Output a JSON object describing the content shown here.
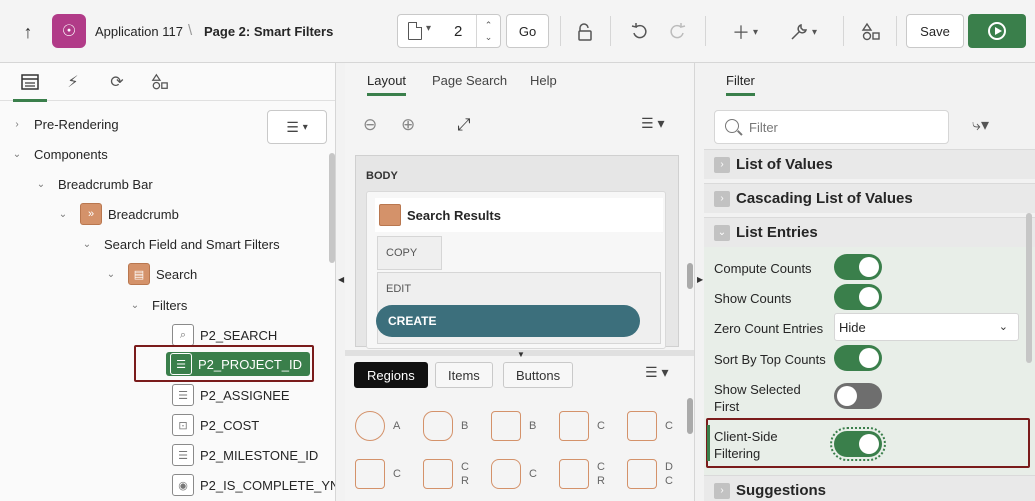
{
  "toolbar": {
    "up_glyph": "↑",
    "app_icon_glyph": "☉",
    "app_name": "Application 117",
    "separator": "\\",
    "page_name": "Page 2: Smart Filters",
    "page_number": "2",
    "go_label": "Go",
    "save_label": "Save",
    "icons": [
      "up-arrow-icon",
      "app-rocket-icon",
      "page-icon",
      "lock-icon",
      "undo-icon",
      "redo-icon",
      "plus-icon",
      "wrench-icon",
      "shapes-icon",
      "run-icon"
    ]
  },
  "left": {
    "tabs": [
      "rendering-tab",
      "dynamic-actions-tab",
      "processing-tab",
      "shared-components-tab"
    ],
    "tree": {
      "pre_rendering": "Pre-Rendering",
      "components": "Components",
      "breadcrumb_bar": "Breadcrumb Bar",
      "breadcrumb": "Breadcrumb",
      "search_field": "Search Field and Smart Filters",
      "search": "Search",
      "filters": "Filters",
      "items": [
        "P2_SEARCH",
        "P2_PROJECT_ID",
        "P2_ASSIGNEE",
        "P2_COST",
        "P2_MILESTONE_ID",
        "P2_IS_COMPLETE_YN"
      ]
    }
  },
  "middle": {
    "tabs": [
      "Layout",
      "Page Search",
      "Help"
    ],
    "body_label": "BODY",
    "region_title": "Search Results",
    "slot_copy": "COPY",
    "slot_edit": "EDIT",
    "create_label": "CREATE",
    "gallery_tabs": [
      "Regions",
      "Items",
      "Buttons"
    ],
    "gallery_items": [
      {
        "label": "A",
        "icon": "user-icon"
      },
      {
        "label": "B",
        "icon": "badge-icon"
      },
      {
        "label": "B",
        "icon": "breadcrumb-icon"
      },
      {
        "label": "C",
        "icon": "calendar-icon"
      },
      {
        "label": "C",
        "icon": "card-icon"
      },
      {
        "label": "C",
        "icon": "chart-icon"
      },
      {
        "label": "C\nR",
        "icon": "classic-report-icon"
      },
      {
        "label": "C",
        "icon": "comments-icon"
      },
      {
        "label": "C\nR",
        "icon": "checklist-icon"
      },
      {
        "label": "D\nC",
        "icon": "dynamic-content-icon"
      }
    ]
  },
  "right": {
    "tab": "Filter",
    "filter_placeholder": "Filter",
    "sections": {
      "list_of_values": "List of Values",
      "cascading": "Cascading List of Values",
      "list_entries": "List Entries",
      "suggestions": "Suggestions"
    },
    "properties": {
      "compute_counts": {
        "label": "Compute Counts",
        "value": "on"
      },
      "show_counts": {
        "label": "Show Counts",
        "value": "on"
      },
      "zero_count_entries": {
        "label": "Zero Count Entries",
        "value": "Hide"
      },
      "sort_by_top_counts": {
        "label": "Sort By Top Counts",
        "value": "on"
      },
      "show_selected_first": {
        "label": "Show Selected First",
        "value": "off"
      },
      "client_side_filtering": {
        "label": "Client-Side Filtering",
        "value": "on"
      }
    }
  },
  "colors": {
    "accent_green": "#3a7f4b",
    "app_icon": "#b13b88",
    "create_button": "#3c6f7c",
    "highlight_border": "#7a1b1b"
  }
}
